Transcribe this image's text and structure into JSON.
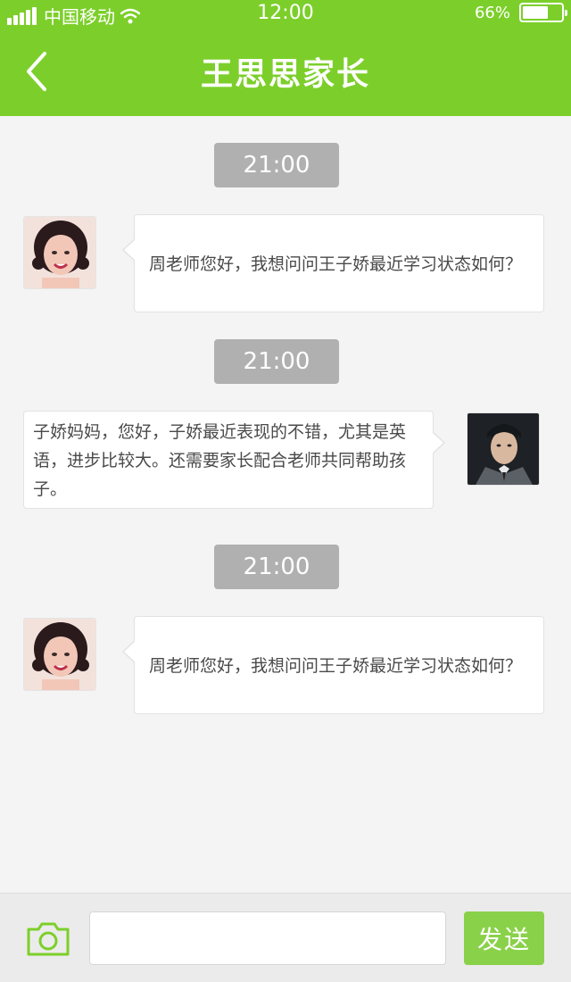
{
  "status_bar": {
    "carrier": "中国移动",
    "time": "12:00",
    "battery_percent": "66%",
    "battery_level": 0.66
  },
  "header": {
    "title": "王思思家长",
    "back_icon": "chevron-left-icon",
    "background_color": "#7ccf2a"
  },
  "messages": [
    {
      "time": "21:00",
      "side": "left",
      "sender": "parent",
      "text": "周老师您好，我想问问王子娇最近学习状态如何？"
    },
    {
      "time": "21:00",
      "side": "right",
      "sender": "teacher",
      "text": "子娇妈妈，您好，子娇最近表现的不错，尤其是英语，进步比较大。还需要家长配合老师共同帮助孩子。"
    },
    {
      "time": "21:00",
      "side": "left",
      "sender": "parent",
      "text": "周老师您好，我想问问王子娇最近学习状态如何？"
    }
  ],
  "input_bar": {
    "camera_icon": "camera-icon",
    "placeholder": "",
    "send_label": "发送",
    "send_color": "#8ad14a"
  }
}
